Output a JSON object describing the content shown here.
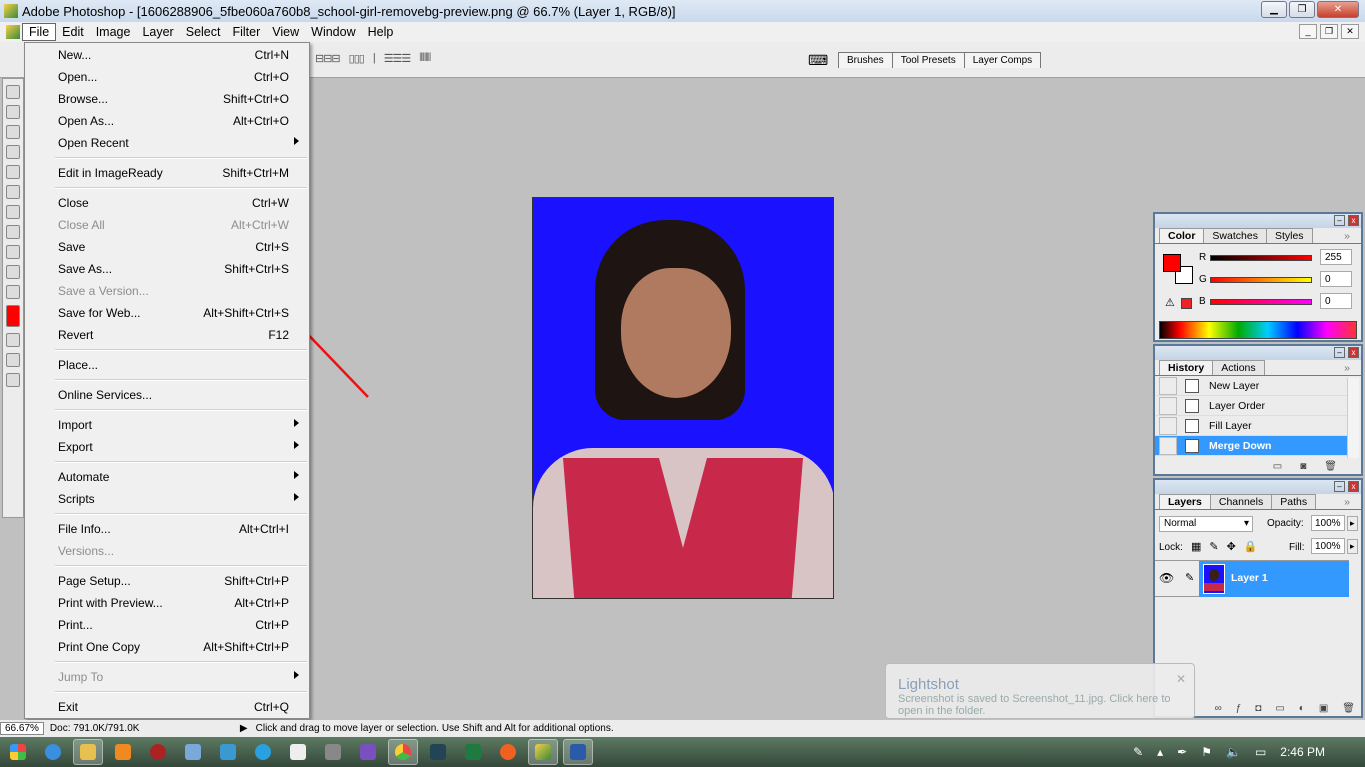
{
  "window": {
    "title": "Adobe Photoshop - [1606288906_5fbe060a760b8_school-girl-removebg-preview.png @ 66.7% (Layer 1, RGB/8)]"
  },
  "menubar": [
    "File",
    "Edit",
    "Image",
    "Layer",
    "Select",
    "Filter",
    "View",
    "Window",
    "Help"
  ],
  "palette_well": [
    "Brushes",
    "Tool Presets",
    "Layer Comps"
  ],
  "file_menu": [
    {
      "label": "New...",
      "shortcut": "Ctrl+N"
    },
    {
      "label": "Open...",
      "shortcut": "Ctrl+O"
    },
    {
      "label": "Browse...",
      "shortcut": "Shift+Ctrl+O"
    },
    {
      "label": "Open As...",
      "shortcut": "Alt+Ctrl+O"
    },
    {
      "label": "Open Recent",
      "submenu": true
    },
    {
      "sep": true
    },
    {
      "label": "Edit in ImageReady",
      "shortcut": "Shift+Ctrl+M"
    },
    {
      "sep": true
    },
    {
      "label": "Close",
      "shortcut": "Ctrl+W"
    },
    {
      "label": "Close All",
      "shortcut": "Alt+Ctrl+W",
      "disabled": true
    },
    {
      "label": "Save",
      "shortcut": "Ctrl+S"
    },
    {
      "label": "Save As...",
      "shortcut": "Shift+Ctrl+S"
    },
    {
      "label": "Save a Version...",
      "disabled": true
    },
    {
      "label": "Save for Web...",
      "shortcut": "Alt+Shift+Ctrl+S"
    },
    {
      "label": "Revert",
      "shortcut": "F12"
    },
    {
      "sep": true
    },
    {
      "label": "Place..."
    },
    {
      "sep": true
    },
    {
      "label": "Online Services..."
    },
    {
      "sep": true
    },
    {
      "label": "Import",
      "submenu": true
    },
    {
      "label": "Export",
      "submenu": true
    },
    {
      "sep": true
    },
    {
      "label": "Automate",
      "submenu": true
    },
    {
      "label": "Scripts",
      "submenu": true
    },
    {
      "sep": true
    },
    {
      "label": "File Info...",
      "shortcut": "Alt+Ctrl+I"
    },
    {
      "label": "Versions...",
      "disabled": true
    },
    {
      "sep": true
    },
    {
      "label": "Page Setup...",
      "shortcut": "Shift+Ctrl+P"
    },
    {
      "label": "Print with Preview...",
      "shortcut": "Alt+Ctrl+P"
    },
    {
      "label": "Print...",
      "shortcut": "Ctrl+P"
    },
    {
      "label": "Print One Copy",
      "shortcut": "Alt+Shift+Ctrl+P"
    },
    {
      "sep": true
    },
    {
      "label": "Jump To",
      "submenu": true,
      "disabled": true
    },
    {
      "sep": true
    },
    {
      "label": "Exit",
      "shortcut": "Ctrl+Q"
    }
  ],
  "color_panel": {
    "tabs": [
      "Color",
      "Swatches",
      "Styles"
    ],
    "r_label": "R",
    "g_label": "G",
    "b_label": "B",
    "r": "255",
    "g": "0",
    "b": "0",
    "foreground": "#ff0000"
  },
  "history_panel": {
    "tabs": [
      "History",
      "Actions"
    ],
    "items": [
      "New Layer",
      "Layer Order",
      "Fill Layer",
      "Merge Down"
    ]
  },
  "layers_panel": {
    "tabs": [
      "Layers",
      "Channels",
      "Paths"
    ],
    "blend_mode": "Normal",
    "opacity_label": "Opacity:",
    "opacity": "100%",
    "lock_label": "Lock:",
    "fill_label": "Fill:",
    "fill": "100%",
    "layer_name": "Layer 1"
  },
  "status": {
    "zoom": "66.67%",
    "doc": "Doc: 791.0K/791.0K",
    "hint": "Click and drag to move layer or selection.  Use Shift and Alt for additional options."
  },
  "lightshot": {
    "title": "Lightshot",
    "message": "Screenshot is saved to Screenshot_11.jpg. Click here to open in the folder."
  },
  "taskbar": {
    "time": "2:46 PM"
  }
}
